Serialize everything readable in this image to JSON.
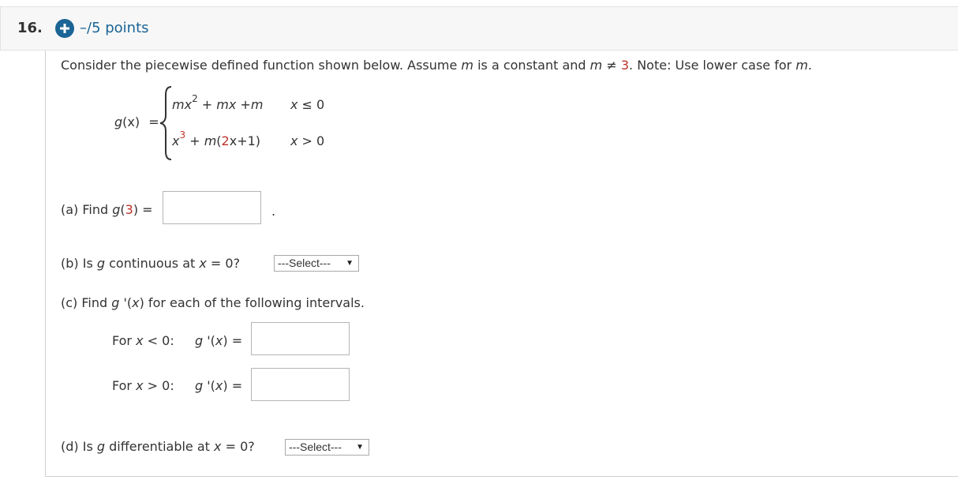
{
  "question": {
    "number": "16.",
    "points": "–/5 points"
  },
  "intro": {
    "text_1": "Consider the piecewise defined function shown below. Assume ",
    "m1": "m",
    "text_2": " is a constant and ",
    "m2": "m",
    "neq": " ≠ ",
    "excluded_value": "3",
    "text_3": ". Note: Use lower case for ",
    "m3": "m",
    "period": "."
  },
  "function": {
    "lhs_g": "g",
    "lhs_arg": "(x)",
    "lhs_eq": "=",
    "case1_m": "mx",
    "case1_exp": "2",
    "case1_rest_a": " + ",
    "case1_rest_b": "mx",
    "case1_rest_c": " +",
    "case1_rest_d": "m",
    "case1_cond_x": "x",
    "case1_cond_op": " ≤ 0",
    "case2_x": "x",
    "case2_exp": "3",
    "case2_plus": " + ",
    "case2_m": "m",
    "case2_paren_open": "(",
    "case2_two": "2",
    "case2_x2": "x",
    "case2_plus1": "+1",
    "case2_paren_close": ")",
    "case2_cond_x": "x",
    "case2_cond_op": " > 0"
  },
  "part_a": {
    "label": "(a) Find ",
    "g": "g",
    "arg_open": "(",
    "arg_value": "3",
    "arg_close": ")",
    "eq": " =",
    "value": "",
    "trailing": "."
  },
  "part_b": {
    "label": "(b) Is ",
    "g": "g",
    "text": " continuous at ",
    "x": "x",
    "tail": " = 0?",
    "select_value": "---Select---"
  },
  "part_c": {
    "label": "(c) Find  ",
    "g": "g",
    "prime": " '(",
    "x": "x",
    "close": ")",
    "tail": "  for each of the following intervals.",
    "row1_for": "For ",
    "row1_x": "x",
    "row1_cond": " < 0:",
    "row1_g": "g",
    "row1_prime": " '(",
    "row1_x2": "x",
    "row1_eq": ") =",
    "row1_value": "",
    "row2_for": "For ",
    "row2_x": "x",
    "row2_cond": " > 0:",
    "row2_g": "g",
    "row2_prime": " '(",
    "row2_x2": "x",
    "row2_eq": ") =",
    "row2_value": ""
  },
  "part_d": {
    "label": "(d) Is ",
    "g": "g",
    "text": " differentiable at ",
    "x": "x",
    "tail": " = 0?",
    "select_value": "---Select---"
  },
  "colors": {
    "accent_blue": "#1a6496",
    "highlight_red": "#c0312b",
    "header_bg": "#f7f7f7"
  }
}
